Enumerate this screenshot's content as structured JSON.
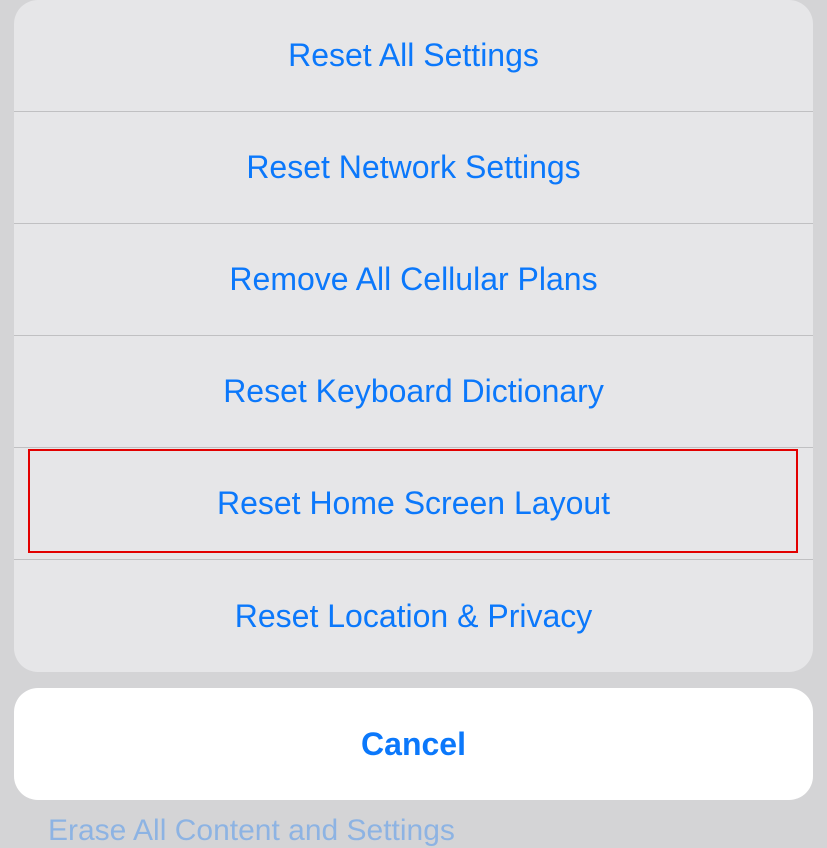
{
  "actionSheet": {
    "items": [
      {
        "label": "Reset All Settings"
      },
      {
        "label": "Reset Network Settings"
      },
      {
        "label": "Remove All Cellular Plans"
      },
      {
        "label": "Reset Keyboard Dictionary"
      },
      {
        "label": "Reset Home Screen Layout"
      },
      {
        "label": "Reset Location & Privacy"
      }
    ]
  },
  "cancel": {
    "label": "Cancel"
  },
  "backgroundHint": "Erase All Content and Settings"
}
